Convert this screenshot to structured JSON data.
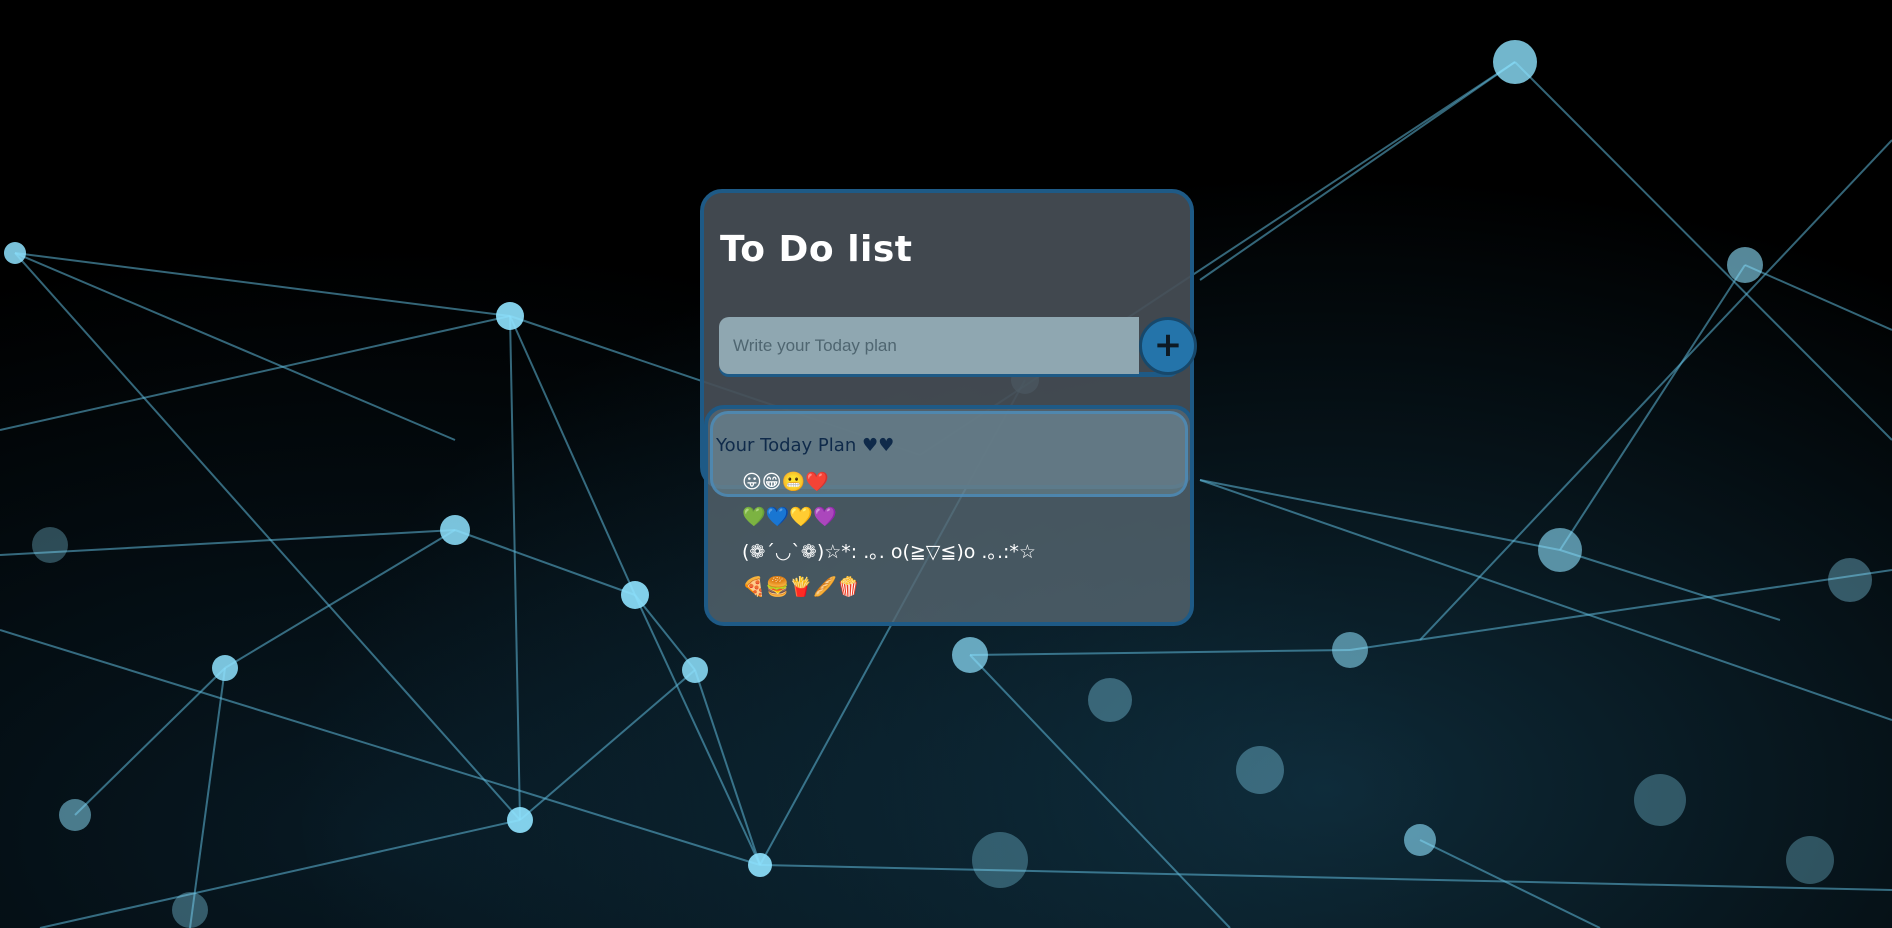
{
  "app": {
    "title": "To Do list"
  },
  "input": {
    "placeholder": "Write your Today plan",
    "value": ""
  },
  "add_button": {
    "label": "+"
  },
  "plan": {
    "heading": "Your Today Plan ♥♥",
    "items": [
      "😛😁😬❤️",
      "💚💙💛💜",
      "(❁´◡`❁)☆*: .｡. o(≧▽≦)o .｡.:*☆",
      "🍕🍔🍟🥖🍿"
    ]
  },
  "colors": {
    "accent": "#1e5a86",
    "button": "#2474aa",
    "card": "#464e56",
    "input_bg": "#8fa7b1",
    "heading_text": "#0f2a4a"
  }
}
